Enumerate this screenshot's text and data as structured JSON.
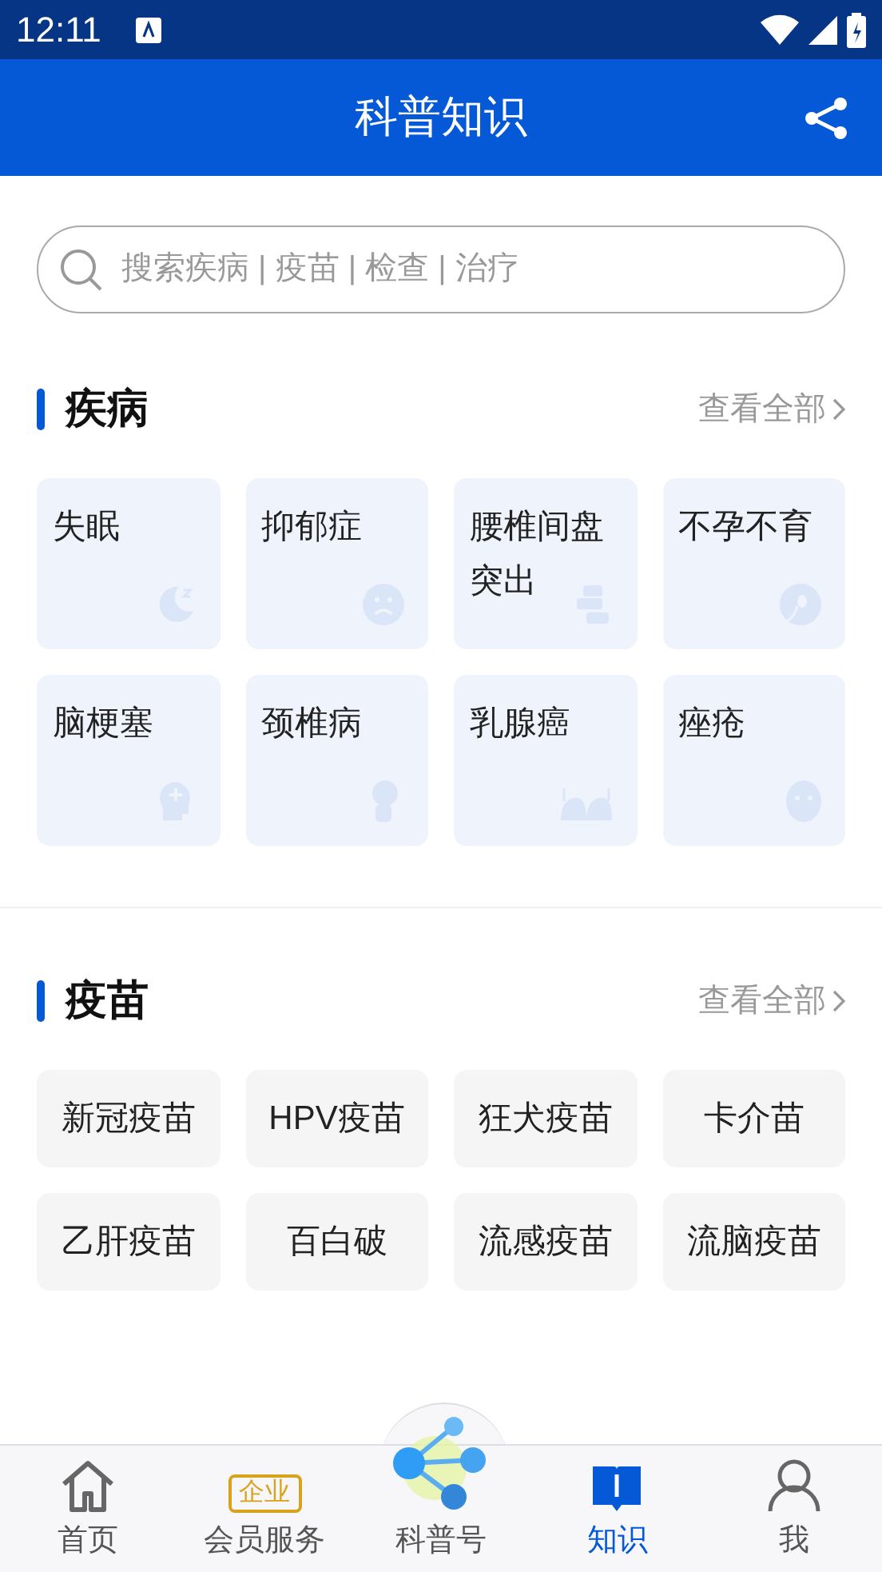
{
  "status_bar": {
    "time": "12:11"
  },
  "header": {
    "title": "科普知识"
  },
  "search": {
    "placeholder": "搜索疾病 | 疫苗 | 检查 | 治疗"
  },
  "sections": [
    {
      "kind": "tiles",
      "title": "疾病",
      "more": "查看全部",
      "items": [
        "失眠",
        "抑郁症",
        "腰椎间盘突出",
        "不孕不育",
        "脑梗塞",
        "颈椎病",
        "乳腺癌",
        "痤疮"
      ]
    },
    {
      "kind": "chips",
      "title": "疫苗",
      "more": "查看全部",
      "items": [
        "新冠疫苗",
        "HPV疫苗",
        "狂犬疫苗",
        "卡介苗",
        "乙肝疫苗",
        "百白破",
        "流感疫苗",
        "流脑疫苗"
      ]
    }
  ],
  "nav": [
    {
      "kind": "home",
      "label": "首页",
      "selected": false
    },
    {
      "kind": "badge",
      "badge": "企业",
      "label": "会员服务",
      "selected": false
    },
    {
      "kind": "center",
      "label": "科普号",
      "selected": false
    },
    {
      "kind": "book",
      "label": "知识",
      "selected": true
    },
    {
      "kind": "person",
      "label": "我",
      "selected": false
    }
  ]
}
